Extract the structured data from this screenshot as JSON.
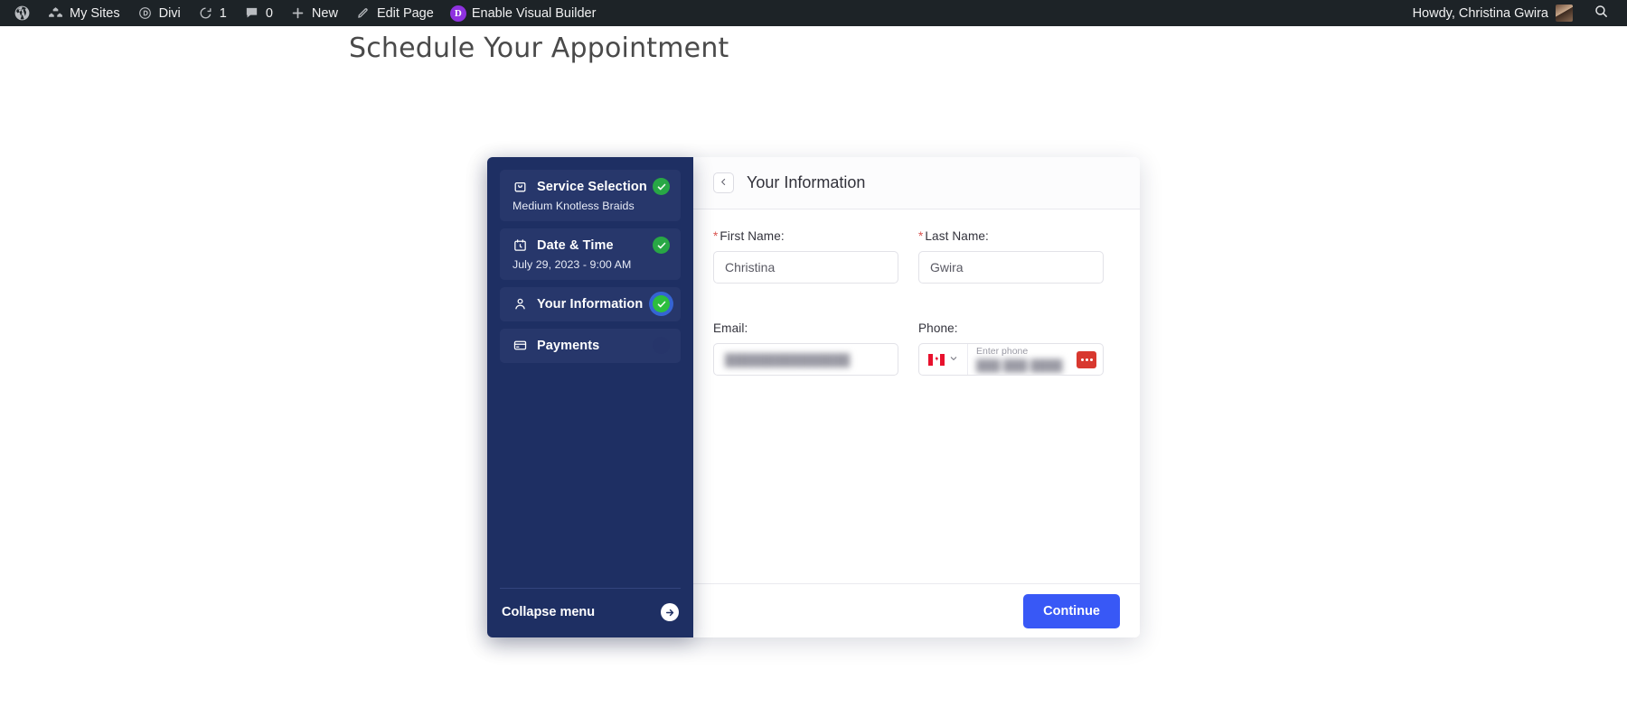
{
  "adminbar": {
    "left_items": [
      {
        "icon": "wordpress-logo-icon",
        "label": ""
      },
      {
        "icon": "my-sites-icon",
        "label": "My Sites"
      },
      {
        "icon": "divi-icon",
        "label": "Divi"
      },
      {
        "icon": "updates-icon",
        "label": "1"
      },
      {
        "icon": "comments-icon",
        "label": "0"
      },
      {
        "icon": "plus-icon",
        "label": "New"
      },
      {
        "icon": "pencil-icon",
        "label": "Edit Page"
      },
      {
        "icon": "divi-visual-builder-icon",
        "label": "Enable Visual Builder"
      }
    ],
    "divi_badge_letter": "D",
    "howdy": "Howdy, Christina Gwira",
    "search_icon": "search-icon",
    "background": "#1d2327"
  },
  "page": {
    "title": "Schedule Your Appointment"
  },
  "sidebar": {
    "background": "#1e2f63",
    "steps": [
      {
        "icon": "shopping-bag-icon",
        "title": "Service Selection",
        "subtitle": "Medium Knotless Braids",
        "state": "done"
      },
      {
        "icon": "calendar-clock-icon",
        "title": "Date & Time",
        "subtitle": "July 29, 2023 - 9:00 AM",
        "state": "done"
      },
      {
        "icon": "user-icon",
        "title": "Your Information",
        "subtitle": "",
        "state": "active"
      },
      {
        "icon": "credit-card-icon",
        "title": "Payments",
        "subtitle": "",
        "state": "pending"
      }
    ],
    "collapse": {
      "label": "Collapse menu",
      "icon": "arrow-right-circle-icon"
    }
  },
  "panel": {
    "back_icon": "chevron-left-icon",
    "title": "Your Information",
    "fields": {
      "first_name": {
        "label": "First Name:",
        "required": true,
        "value": "Christina",
        "placeholder": ""
      },
      "last_name": {
        "label": "Last Name:",
        "required": true,
        "value": "Gwira",
        "placeholder": ""
      },
      "email": {
        "label": "Email:",
        "required": false,
        "value": "███████████████",
        "redacted": true
      },
      "phone": {
        "label": "Phone:",
        "required": false,
        "country_flag": "canada-flag-icon",
        "dropdown_icon": "chevron-down-icon",
        "placeholder": "Enter phone",
        "value": "███ ███ ████",
        "redacted": true,
        "format_icon": "phone-format-icon"
      }
    },
    "footer": {
      "continue_label": "Continue",
      "accent": "#3858f6"
    }
  }
}
